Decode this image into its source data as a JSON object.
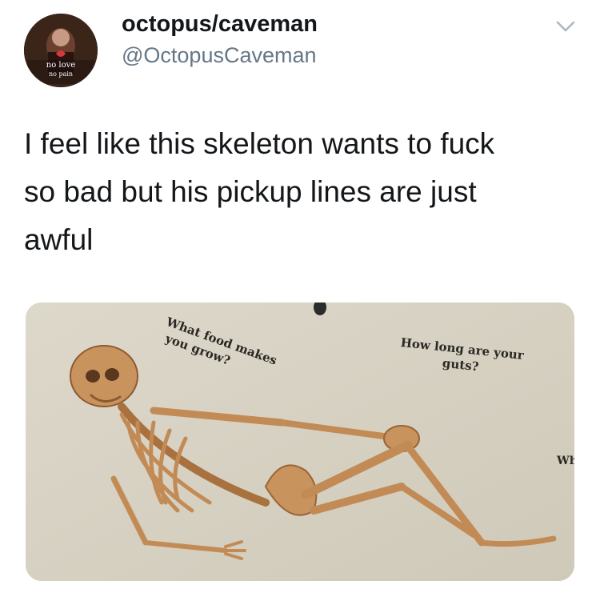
{
  "author": {
    "display_name": "octopus/caveman",
    "handle": "@OctopusCaveman",
    "avatar_caption_line1": "no love",
    "avatar_caption_line2": "no pain"
  },
  "tweet": {
    "text_lines": [
      "I feel like this skeleton wants to fuck",
      "so bad but his pickup lines are just",
      "awful"
    ]
  },
  "media": {
    "bubbles": [
      {
        "lines": [
          "What food makes",
          "you grow?"
        ]
      },
      {
        "lines": [
          "How long are your",
          "guts?"
        ]
      },
      {
        "lines": [
          "Wh"
        ]
      }
    ],
    "colors": {
      "page": "#d9d4c6",
      "bone": "#c9935f",
      "bone_shade": "#9a6436"
    }
  },
  "icons": {
    "menu": "chevron-down-icon"
  }
}
